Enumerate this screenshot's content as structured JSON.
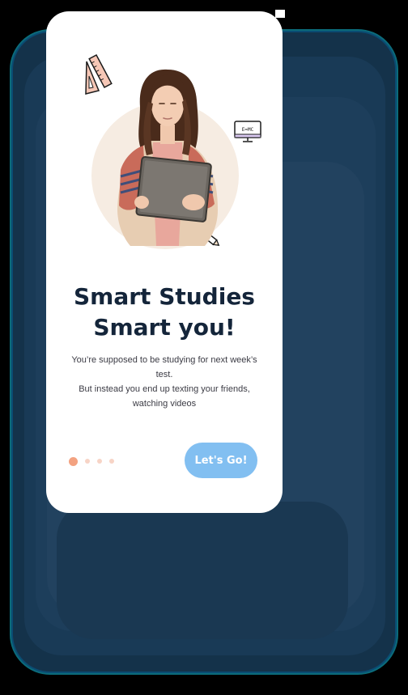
{
  "onboarding": {
    "title_line1": "Smart Studies",
    "title_line2": "Smart you!",
    "description_line1": "You’re supposed to be studying for next week’s test.",
    "description_line2": "But instead you end up texting your friends,",
    "description_line3": "watching videos",
    "cta_label": "Let's Go!",
    "monitor_text": "E=MC",
    "pagination": {
      "total": 4,
      "active_index": 0
    }
  },
  "colors": {
    "accent": "#82bff1",
    "active_dot": "#f3a281",
    "inactive_dot": "#f7d4c6",
    "title": "#14253a",
    "background": "#000000",
    "card": "#ffffff"
  },
  "icons": {
    "ruler": "ruler-icon",
    "triangle": "set-square-icon",
    "monitor": "monitor-icon",
    "pencil": "pencil-icon"
  }
}
